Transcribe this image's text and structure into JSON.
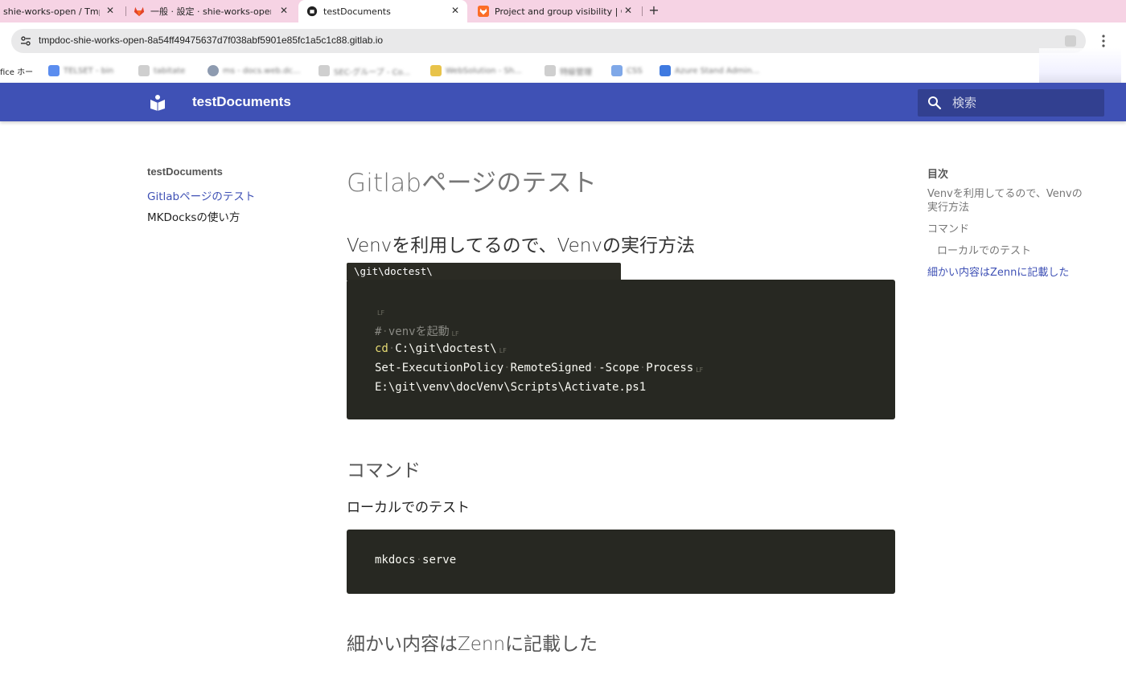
{
  "browser": {
    "tabs": [
      {
        "title": "shie-works-open / TmpD",
        "active": false
      },
      {
        "title": "一般 · 設定 · shie-works-open /",
        "active": false
      },
      {
        "title": "testDocuments",
        "active": true
      },
      {
        "title": "Project and group visibility | Git",
        "active": false
      }
    ],
    "close_glyph": "✕",
    "new_tab_glyph": "+",
    "url": "tmpdoc-shie-works-open-8a54ff49475637d7f038abf5901e85fc1a5c1c88.gitlab.io",
    "bookmarks": [
      {
        "label": "fice ホー",
        "color": ""
      },
      {
        "label": "TELSET - bin",
        "color": "#5b8def"
      },
      {
        "label": "tabitate",
        "color": "#cfcfcf"
      },
      {
        "label": "ms - docs.web.dc...",
        "color": "#8e9bb0"
      },
      {
        "label": "SEC-グループ - Co...",
        "color": "#cfcfcf"
      },
      {
        "label": "WebSolution - Sh...",
        "color": "#e8c34a"
      },
      {
        "label": "特級管理",
        "color": "#cfcfcf"
      },
      {
        "label": "CSS",
        "color": "#7fa8e8"
      },
      {
        "label": "Azure Stand Admin...",
        "color": "#3f7ae0"
      }
    ]
  },
  "site": {
    "title": "testDocuments",
    "search_placeholder": "検索",
    "accent_color": "#3f51b5"
  },
  "nav": {
    "title": "testDocuments",
    "items": [
      {
        "label": "Gitlabページのテスト",
        "active": true
      },
      {
        "label": "MKDocksの使い方",
        "active": false
      }
    ]
  },
  "content": {
    "h1": "Gitlabページのテスト",
    "section1_heading": "Venvを利用してるので、Venvの実行方法",
    "code1_filename": "\\git\\doctest\\",
    "code1_lines": {
      "comment_hash": "#",
      "comment_text": "venvを起動",
      "cd": "cd",
      "cd_path": "C:\\git\\doctest\\",
      "set_cmd": "Set-ExecutionPolicy",
      "set_arg1": "RemoteSigned",
      "set_arg2": "-Scope",
      "set_arg3": "Process",
      "activate": "E:\\git\\venv\\docVenv\\Scripts\\Activate.ps1",
      "lf": "LF"
    },
    "section2_heading": "コマンド",
    "subsection_heading": "ローカルでのテスト",
    "code2": {
      "cmd": "mkdocs",
      "arg": "serve"
    },
    "section3_heading": "細かい内容はZennに記載した"
  },
  "toc": {
    "title": "目次",
    "items": [
      {
        "label": "Venvを利用してるので、Venvの実行方法",
        "level": 1,
        "active": false
      },
      {
        "label": "コマンド",
        "level": 1,
        "active": false
      },
      {
        "label": "ローカルでのテスト",
        "level": 2,
        "active": false
      },
      {
        "label": "細かい内容はZennに記載した",
        "level": 1,
        "active": true
      }
    ]
  }
}
